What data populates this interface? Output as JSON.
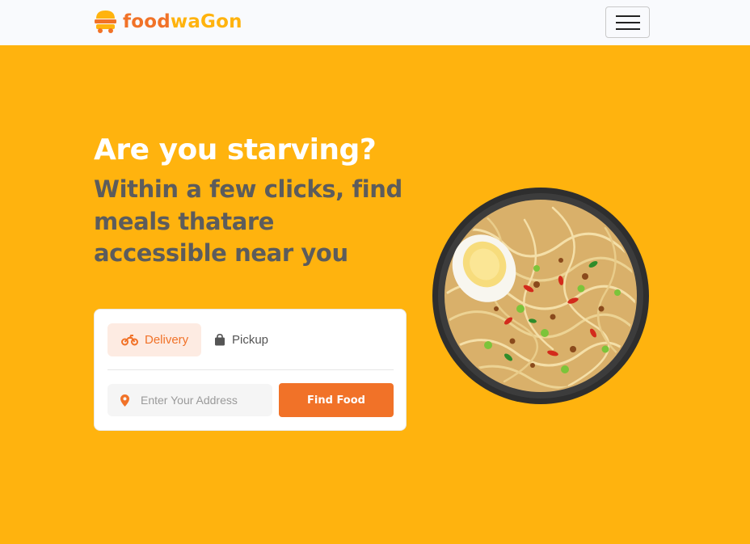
{
  "brand": {
    "name_part1": "food",
    "name_part2": "waGon",
    "primary_color": "#f17228",
    "accent_color": "#ffb30e"
  },
  "nav": {
    "menu_icon": "hamburger-menu-icon"
  },
  "hero": {
    "title": "Are you starving?",
    "subtitle": "Within a few clicks, find meals thatare accessible near you",
    "background_color": "#ffb30e"
  },
  "search_card": {
    "tabs": [
      {
        "label": "Delivery",
        "icon": "motorcycle-icon",
        "active": true
      },
      {
        "label": "Pickup",
        "icon": "shopping-bag-icon",
        "active": false
      }
    ],
    "address_placeholder": "Enter Your Address",
    "address_icon": "map-pin-icon",
    "submit_label": "Find Food"
  },
  "hero_image": {
    "subject": "noodle-bowl-image"
  }
}
